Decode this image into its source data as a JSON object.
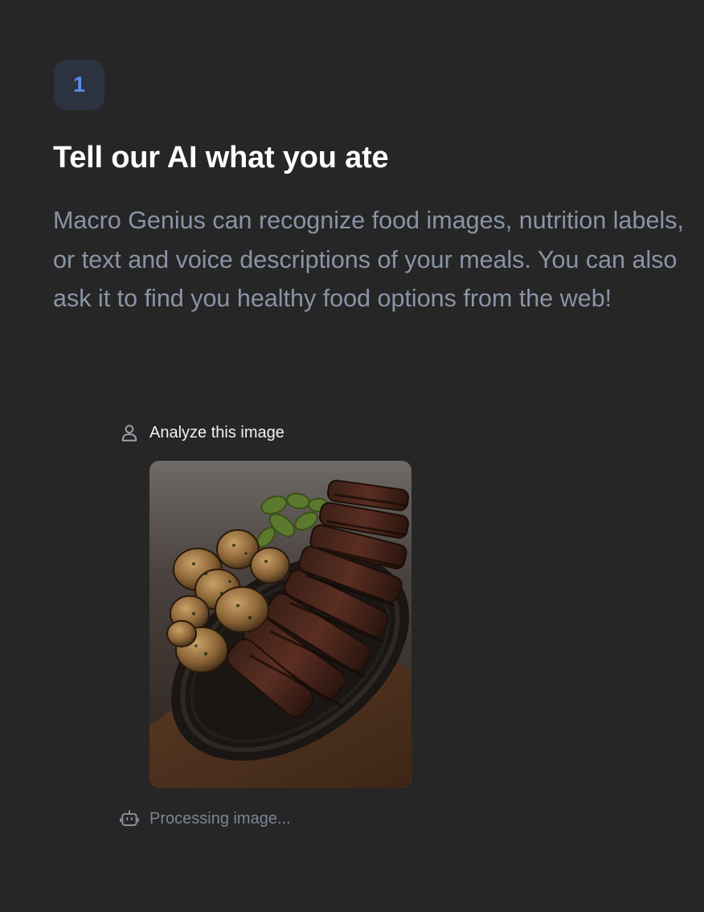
{
  "step": {
    "number": "1"
  },
  "heading": {
    "title": "Tell our AI what you ate"
  },
  "intro": {
    "description": "Macro Genius can recognize food images, nutrition labels, or text and voice descriptions of your meals. You can also ask it to find you healthy food options from the web!"
  },
  "chat": {
    "user_message": {
      "icon": "user-icon",
      "text": "Analyze this image"
    },
    "attachment": {
      "subject": "steak-with-potatoes-and-peppers-photo"
    },
    "bot_message": {
      "icon": "bot-icon",
      "text": "Processing image..."
    }
  },
  "colors": {
    "background": "#262626",
    "badge_bg": "#2c323f",
    "badge_text": "#5b8def",
    "title": "#ffffff",
    "body_text": "#8a94a6",
    "status_text": "#7c8494"
  }
}
